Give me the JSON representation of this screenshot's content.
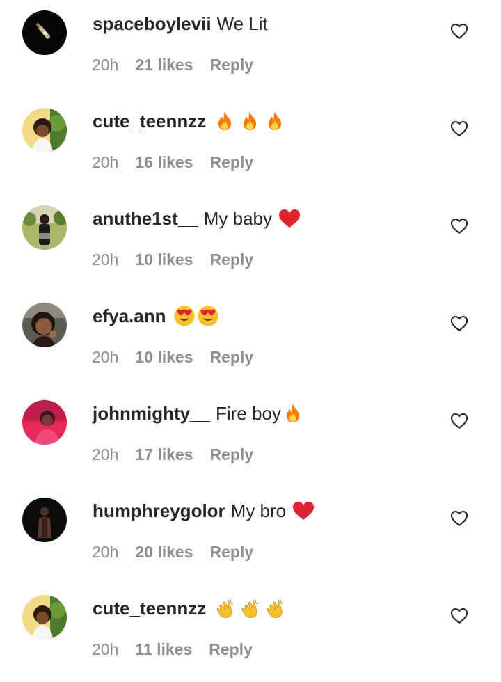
{
  "comments": [
    {
      "username": "spaceboylevii",
      "text": "We Lit",
      "emoji": [],
      "time": "20h",
      "likes": "21 likes",
      "reply": "Reply",
      "avatar": "bottle-avatar"
    },
    {
      "username": "cute_teennzz",
      "text": "",
      "emoji": [
        "fire-emoji",
        "fire-emoji",
        "fire-emoji"
      ],
      "time": "20h",
      "likes": "16 likes",
      "reply": "Reply",
      "avatar": "girl-avatar"
    },
    {
      "username": "anuthe1st__",
      "text": "My baby",
      "emoji": [
        "red-heart-emoji"
      ],
      "time": "20h",
      "likes": "10 likes",
      "reply": "Reply",
      "avatar": "outdoor-avatar"
    },
    {
      "username": "efya.ann",
      "text": "",
      "emoji": [
        "heart-eyes-emoji",
        "heart-eyes-emoji"
      ],
      "time": "20h",
      "likes": "10 likes",
      "reply": "Reply",
      "avatar": "selfie-avatar"
    },
    {
      "username": "johnmighty__",
      "text": "Fire boy",
      "emoji": [
        "fire-emoji"
      ],
      "time": "20h",
      "likes": "17 likes",
      "reply": "Reply",
      "avatar": "pink-avatar"
    },
    {
      "username": "humphreygolor",
      "text": "My bro",
      "emoji": [
        "red-heart-emoji"
      ],
      "time": "20h",
      "likes": "20 likes",
      "reply": "Reply",
      "avatar": "dark-avatar"
    },
    {
      "username": "cute_teennzz",
      "text": "",
      "emoji": [
        "clapping-hands-emoji",
        "clapping-hands-emoji",
        "clapping-hands-emoji"
      ],
      "time": "20h",
      "likes": "11 likes",
      "reply": "Reply",
      "avatar": "girl-avatar"
    }
  ],
  "colors": {
    "text": "#262626",
    "meta": "#8e8e8e",
    "heart_outline": "#262626",
    "fire": "#f57c00",
    "red_heart": "#e0242f",
    "emoji_yellow": "#f6c12b"
  }
}
